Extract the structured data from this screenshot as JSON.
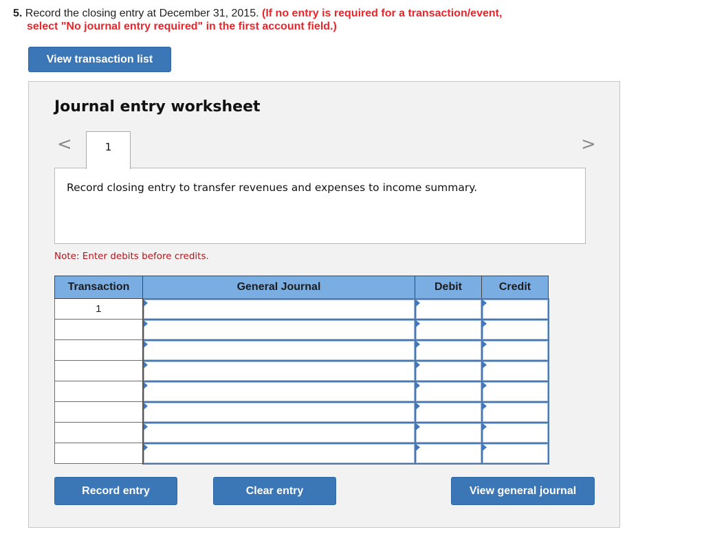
{
  "question": {
    "number": "5.",
    "text": "Record the closing entry at December 31, 2015.",
    "warning_line1": "(If no entry is required for a transaction/event,",
    "warning_line2": "select \"No journal entry required\" in the first account field.)"
  },
  "buttons": {
    "view_transaction_list": "View transaction list",
    "record_entry": "Record entry",
    "clear_entry": "Clear entry",
    "view_general_journal": "View general journal"
  },
  "worksheet": {
    "title": "Journal entry worksheet",
    "nav_prev_icon": "chevron-left-icon",
    "nav_next_icon": "chevron-right-icon",
    "prev_glyph": "<",
    "next_glyph": ">",
    "tabs": [
      {
        "label": "1",
        "active": true
      }
    ],
    "description": "Record closing entry to transfer revenues and expenses to income summary.",
    "note": "Note: Enter debits before credits."
  },
  "table": {
    "headers": [
      "Transaction",
      "General Journal",
      "Debit",
      "Credit"
    ],
    "rows": [
      {
        "transaction": "1",
        "account": "",
        "debit": "",
        "credit": ""
      },
      {
        "transaction": "",
        "account": "",
        "debit": "",
        "credit": ""
      },
      {
        "transaction": "",
        "account": "",
        "debit": "",
        "credit": ""
      },
      {
        "transaction": "",
        "account": "",
        "debit": "",
        "credit": ""
      },
      {
        "transaction": "",
        "account": "",
        "debit": "",
        "credit": ""
      },
      {
        "transaction": "",
        "account": "",
        "debit": "",
        "credit": ""
      },
      {
        "transaction": "",
        "account": "",
        "debit": "",
        "credit": ""
      },
      {
        "transaction": "",
        "account": "",
        "debit": "",
        "credit": ""
      }
    ]
  },
  "colors": {
    "button_blue": "#3b76b6",
    "header_blue": "#7aaee3",
    "warning_red": "#e8262c",
    "note_red": "#b3141c"
  }
}
